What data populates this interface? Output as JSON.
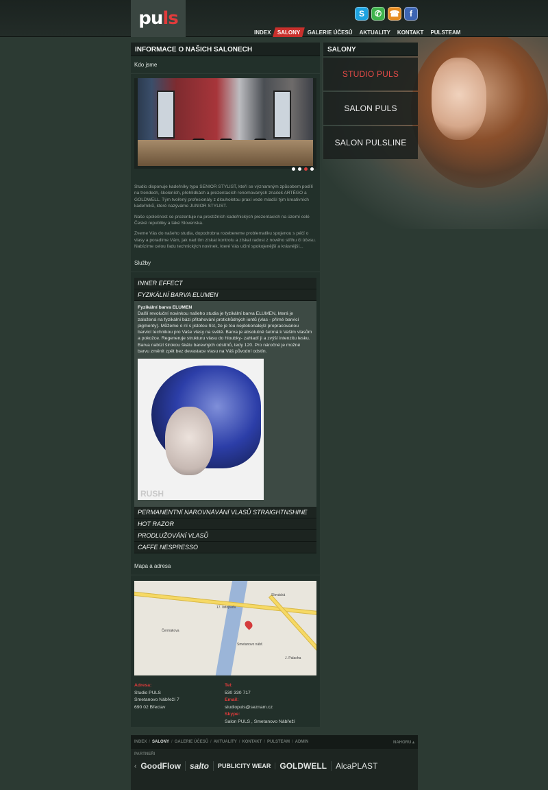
{
  "brand": {
    "logo_main": "pu",
    "logo_accent": "ls"
  },
  "social": [
    {
      "icon": "skype-icon",
      "glyph": "S"
    },
    {
      "icon": "whatsapp-icon",
      "glyph": "✆"
    },
    {
      "icon": "phone-icon",
      "glyph": "☎"
    },
    {
      "icon": "facebook-icon",
      "glyph": "f"
    }
  ],
  "nav": [
    "INDEX",
    "SALONY",
    "GALERIE ÚČESŮ",
    "AKTUALITY",
    "KONTAKT",
    "PULSTEAM"
  ],
  "nav_active": "SALONY",
  "main": {
    "title": "INFORMACE O NAŠICH SALONECH",
    "kdo_jsme": "Kdo jsme",
    "about": [
      "Studio disponuje kadeřníky typu SENIOR STYLIST, kteří se významným způsobem podílí na trendech, školeních, přehlídkách a prezentacích renomovaných značek ARTÉGO a GOLDWELL. Tým tvořený profesionály z dlouholetou praxí vede mladší tým kreativních kadeřníků, které nazýváme JUNIOR STYLIST.",
      "Naše společnost se prezentuje na prestižních kadeřnických prezentacích na území celé České republiky a také Slovenska.",
      "Zveme Vás do našeho studia, dopodrobna rozebereme problematiku spojenou s péčí o vlasy a poradíme Vám, jak nad tím získat kontrolu a získat radost z nového střihu či účesu. Nabízíme celou řadu technických novinek, které Vás učiní spokojenější a krásnější..."
    ],
    "services_label": "Služby",
    "services_top": [
      "INNER EFFECT",
      "FYZIKÁLNÍ BARVA ELUMEN"
    ],
    "service_detail_title": "Fyzikální barva ELUMEN",
    "service_detail_text": "Další revoluční novinkou našeho studia je fyzikální barva ELUMEN, která je založená na fyzikální bázi přitahování protichůdných iontů (vlas - přímé barvicí pigmenty). Můžeme o ní s jistotou říct, že je tou nejdokonalejší propracovanou barvicí technikou pro Vaše vlasy na světě. Barva je absolutně šetrná k Vašim vlasům a pokožce. Regeneruje strukturu vlasu do hloubky- zahladí ji a zvýší intenzitu lesku. Barva nabízí širokou škálu barevných odstínů, tedy 120. Pro náročné je možné barvu změnit zpět bez devastace vlasu na Váš původní odstín.",
    "service_image_caption": "RUSH",
    "services_bottom": [
      "PERMANENTNÍ NAROVNÁVÁNÍ VLASŮ STRAIGHTNSHINE",
      "HOT RAZOR",
      "PRODLUŽOVÁNÍ VLASŮ",
      "CAFFE NESPRESSO"
    ],
    "map_label": "Mapa a adresa",
    "map_labels": [
      "17. listopadu",
      "Slovácká",
      "Čermákova",
      "Smetanovo nábř.",
      "J. Palacha"
    ],
    "address": {
      "h": "Adresa:",
      "lines": [
        "Studio PULS",
        "Smetanovo Nábřeží 7",
        "690 02 Břeclav"
      ]
    },
    "contact": {
      "tel_h": "Tel:",
      "tel": "530 330 717",
      "email_h": "Email:",
      "email": "studiopuls@seznam.cz",
      "skype_h": "Skype:",
      "skype": "Salon PULS , Smetanovo Nábřeží"
    },
    "slider_dots": 4,
    "slider_active": 3
  },
  "side": {
    "title": "SALONY",
    "items": [
      "STUDIO PULS",
      "SALON PULS",
      "SALON PULSLINE"
    ],
    "active": 0
  },
  "footer": {
    "nav": [
      "INDEX",
      "SALONY",
      "GALERIE ÚČESŮ",
      "AKTUALITY",
      "KONTAKT",
      "PULSTEAM",
      "ADMIN"
    ],
    "active": "SALONY",
    "top": "NAHORU ▴",
    "partners_label": "PARTNEŘI",
    "partners": [
      "GoodFlow",
      "salto",
      "PUBLICITY WEAR",
      "GOLDWELL",
      "AlcaPLAST"
    ]
  },
  "colors": {
    "accent": "#d9413e",
    "bg": "#2c3a33"
  }
}
